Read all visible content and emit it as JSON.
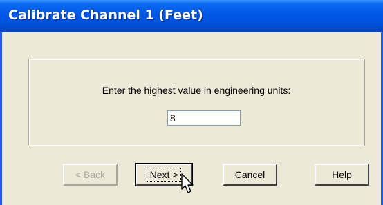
{
  "window": {
    "title": "Calibrate Channel 1 (Feet)"
  },
  "panel": {
    "prompt": "Enter the highest value in engineering units:",
    "value": "8"
  },
  "buttons": {
    "back": {
      "label_pre": "< ",
      "label_accel": "B",
      "label_post": "ack",
      "enabled": false
    },
    "next": {
      "label_accel": "N",
      "label_post": "ext >",
      "enabled": true,
      "default": true
    },
    "cancel": {
      "label": "Cancel",
      "enabled": true
    },
    "help": {
      "label": "Help",
      "enabled": true
    }
  },
  "colors": {
    "title_bar": "#0058e6",
    "dialog_bg": "#ece9d8"
  },
  "icons": {
    "pointer": "mouse-pointer-icon"
  }
}
